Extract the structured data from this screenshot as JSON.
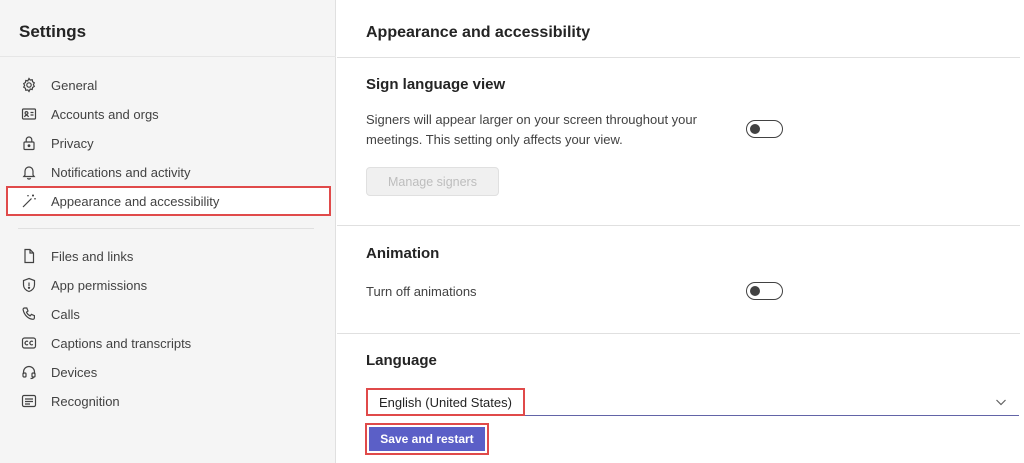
{
  "sidebar": {
    "title": "Settings",
    "items": [
      {
        "label": "General",
        "icon": "gear-icon"
      },
      {
        "label": "Accounts and orgs",
        "icon": "id-card-icon"
      },
      {
        "label": "Privacy",
        "icon": "lock-icon"
      },
      {
        "label": "Notifications and activity",
        "icon": "bell-icon"
      },
      {
        "label": "Appearance and accessibility",
        "icon": "magic-wand-icon",
        "active": true
      },
      {
        "label": "Files and links",
        "icon": "file-icon"
      },
      {
        "label": "App permissions",
        "icon": "shield-icon"
      },
      {
        "label": "Calls",
        "icon": "phone-icon"
      },
      {
        "label": "Captions and transcripts",
        "icon": "cc-icon"
      },
      {
        "label": "Devices",
        "icon": "headset-icon"
      },
      {
        "label": "Recognition",
        "icon": "recognition-icon"
      }
    ]
  },
  "main": {
    "title": "Appearance and accessibility",
    "sign_language": {
      "title": "Sign language view",
      "description_line1": "Signers will appear larger on your screen throughout your",
      "description_line2": "meetings. This setting only affects your view.",
      "toggle_on": false,
      "manage_button": "Manage signers"
    },
    "animation": {
      "title": "Animation",
      "label": "Turn off animations",
      "toggle_on": false
    },
    "language": {
      "title": "Language",
      "selected": "English (United States)",
      "save_button": "Save and restart"
    }
  },
  "colors": {
    "accent": "#5b5fc7",
    "highlight": "#e04a4a"
  }
}
